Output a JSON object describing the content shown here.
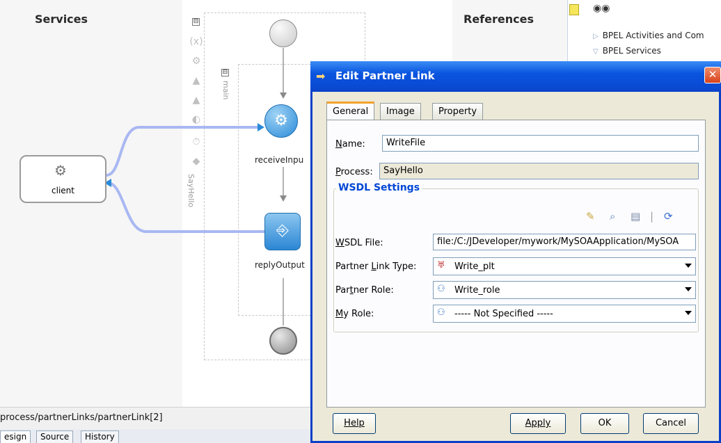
{
  "canvas": {
    "services_title": "Services",
    "references_title": "References",
    "client_label": "client",
    "receive_label": "receiveInpu",
    "reply_label": "replyOutput",
    "scope_label": "main",
    "process_label": "SayHello",
    "collapse_glyph": "⊟"
  },
  "palette": {
    "items": [
      {
        "arrow": "▷",
        "label": "BPEL Activities and Com"
      },
      {
        "arrow": "▽",
        "label": "BPEL Services"
      }
    ]
  },
  "status_bar": {
    "path": "process/partnerLinks/partnerLink[2]"
  },
  "bottom_tabs": [
    {
      "label": "esign",
      "active": true
    },
    {
      "label": "Source",
      "active": false
    },
    {
      "label": "History",
      "active": false
    }
  ],
  "dialog": {
    "title": "Edit Partner Link",
    "close_glyph": "✕",
    "tabs": [
      {
        "label": "General",
        "active": true
      },
      {
        "label": "Image",
        "active": false
      },
      {
        "label": "Property",
        "active": false
      }
    ],
    "name": {
      "label_mnemonic": "N",
      "label_rest": "ame:",
      "value": "WriteFile"
    },
    "process": {
      "label_mnemonic": "P",
      "label_rest": "rocess:",
      "value": "SayHello"
    },
    "wsdl_settings": {
      "legend": "WSDL Settings",
      "wsdl_file": {
        "label_mnemonic": "W",
        "label_rest": "SDL File:",
        "value": "file:/C:/JDeveloper/mywork/MySOAApplication/MySOA"
      },
      "partner_link_type": {
        "label_pre": "Partner ",
        "label_mnemonic": "L",
        "label_rest": "ink Type:",
        "value": "Write_plt",
        "icon": "partner-link-type-icon"
      },
      "partner_role": {
        "label_pre": "Par",
        "label_mnemonic": "t",
        "label_rest": "ner Role:",
        "value": "Write_role",
        "icon": "role-icon"
      },
      "my_role": {
        "label_mnemonic": "M",
        "label_rest": "y Role:",
        "value": "----- Not Specified -----",
        "icon": "role-icon"
      }
    },
    "buttons": {
      "help": "Help",
      "apply": "Apply",
      "ok": "OK",
      "cancel": "Cancel"
    }
  },
  "colors": {
    "titlebar": "#0a55e0",
    "legend": "#0046d5",
    "flow_line": "#a9b8f2",
    "activity": "#2a8ad8"
  }
}
